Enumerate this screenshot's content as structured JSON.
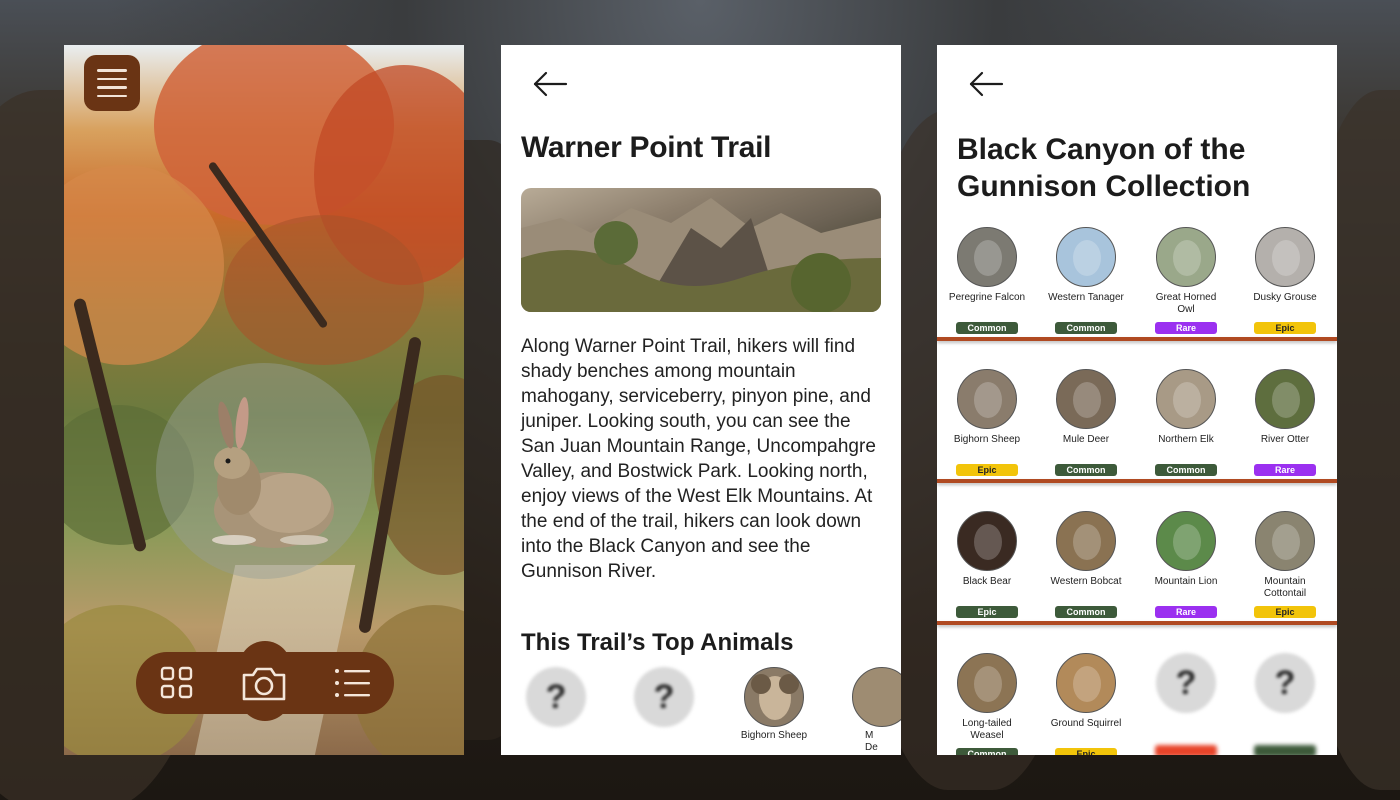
{
  "colors": {
    "brown_brand": "#6a3414",
    "common": "#3d5a3a",
    "rare": "#9b30f0",
    "epic": "#f2c40a",
    "separator": "#b04a22"
  },
  "camera_screen": {
    "menu_icon": "hamburger-icon",
    "nav": {
      "left_icon": "grid-icon",
      "center_icon": "camera-icon",
      "right_icon": "list-icon"
    }
  },
  "trail_screen": {
    "back_icon": "arrow-left-icon",
    "title": "Warner Point Trail",
    "description": "Along Warner Point Trail, hikers will find shady benches among mountain mahogany, serviceberry, pinyon pine, and juniper. Looking south, you can see the San Juan Mountain Range, Uncompahgre Valley, and Bostwick Park. Looking north, enjoy views of the West Elk Mountains. At the end of the trail, hikers can look down into the Black Canyon and see the Gunnison River.",
    "top_animals_heading": "This Trail’s Top Animals",
    "top_animals": [
      {
        "name": "",
        "known": false,
        "unknown_glyph": "?"
      },
      {
        "name": "",
        "known": false,
        "unknown_glyph": "?"
      },
      {
        "name": "Bighorn Sheep",
        "known": true
      },
      {
        "name": "M\nDe",
        "known": true
      }
    ]
  },
  "collection_screen": {
    "back_icon": "arrow-left-icon",
    "title": "Black Canyon of the Gunnison Collection",
    "rows": [
      [
        {
          "name": "Peregrine Falcon",
          "rarity": "Common",
          "tone": "common"
        },
        {
          "name": "Western Tanager",
          "rarity": "Common",
          "tone": "common"
        },
        {
          "name": "Great Horned Owl",
          "rarity": "Rare",
          "tone": "rare"
        },
        {
          "name": "Dusky Grouse",
          "rarity": "Epic",
          "tone": "epic"
        }
      ],
      [
        {
          "name": "Bighorn Sheep",
          "rarity": "Epic",
          "tone": "epic"
        },
        {
          "name": "Mule Deer",
          "rarity": "Common",
          "tone": "common"
        },
        {
          "name": "Northern Elk",
          "rarity": "Common",
          "tone": "common"
        },
        {
          "name": "River Otter",
          "rarity": "Rare",
          "tone": "rare"
        }
      ],
      [
        {
          "name": "Black Bear",
          "rarity": "Epic",
          "tone": "common"
        },
        {
          "name": "Western Bobcat",
          "rarity": "Common",
          "tone": "common"
        },
        {
          "name": "Mountain Lion",
          "rarity": "Rare",
          "tone": "rare"
        },
        {
          "name": "Mountain Cottontail",
          "rarity": "Epic",
          "tone": "epic"
        }
      ],
      [
        {
          "name": "Long-tailed Weasel",
          "rarity": "Common",
          "tone": "common"
        },
        {
          "name": "Ground Squirrel",
          "rarity": "Epic",
          "tone": "epic"
        },
        {
          "name": "",
          "rarity": "",
          "tone": "unknown-red",
          "unknown": true,
          "unknown_glyph": "?"
        },
        {
          "name": "",
          "rarity": "",
          "tone": "unknown-green",
          "unknown": true,
          "unknown_glyph": "?"
        }
      ]
    ]
  }
}
